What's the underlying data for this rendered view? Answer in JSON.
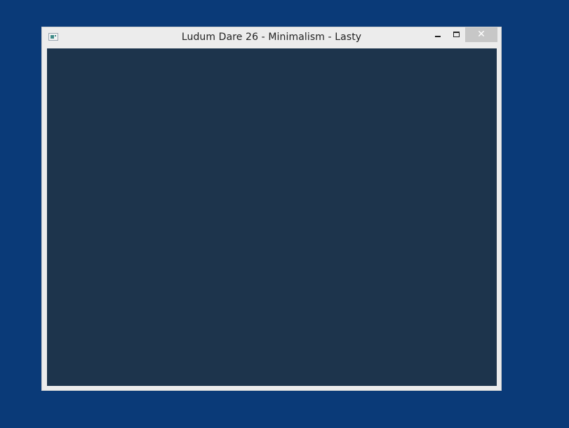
{
  "desktop": {
    "background_color": "#0a3a78"
  },
  "window": {
    "title": "Ludum Dare 26 - Minimalism - Lasty",
    "app_icon": "app-window-icon",
    "controls": {
      "minimize_icon": "minimize-icon",
      "maximize_icon": "maximize-icon",
      "close_icon": "close-icon",
      "close_glyph": "✕"
    },
    "client_background": "#1d344c"
  }
}
